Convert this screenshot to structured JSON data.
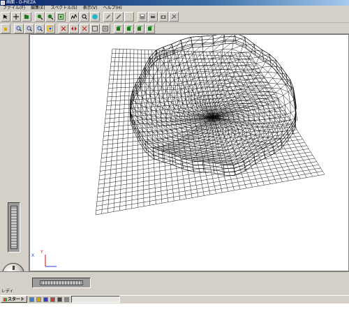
{
  "window": {
    "title": "画面 - D-PIEZA"
  },
  "menu": {
    "items": [
      "ファイル(F)",
      "編集(E)",
      "スペクトル(S)",
      "表示(V)",
      "ヘルプ(H)"
    ]
  },
  "toolbar1": {
    "icons": [
      "select-arrow-icon",
      "crosshair-icon",
      "open-file-icon",
      "zoom-in-icon",
      "zoom-out-icon",
      "zoom-fit-icon",
      "spectrum-icon",
      "search-icon",
      "sphere-icon",
      "pen-icon",
      "ruler-icon",
      "blank-icon",
      "save-icon",
      "print-icon",
      "camera-icon",
      "settings-icon"
    ],
    "colors": {
      "accent": "#1a7a1a",
      "blue": "#1f4fbf",
      "cyan": "#21b6c9"
    }
  },
  "toolbar2": {
    "icons": [
      "hand-icon",
      "zoom-region-icon",
      "zoom-box-icon",
      "zoom-center-icon",
      "zoom-window-icon",
      "cut-icon",
      "mirror-icon",
      "rotate-icon",
      "frame-icon",
      "box-icon",
      "cube-1-icon",
      "cube-2-icon",
      "cube-3-icon",
      "cube-4-icon"
    ]
  },
  "viewport": {
    "axis_label_y": "Y",
    "axis_label_x": "X",
    "mesh_color": "#000000"
  },
  "statusbar": {
    "text": "レディ"
  },
  "taskbar": {
    "start_label": "スタート"
  }
}
